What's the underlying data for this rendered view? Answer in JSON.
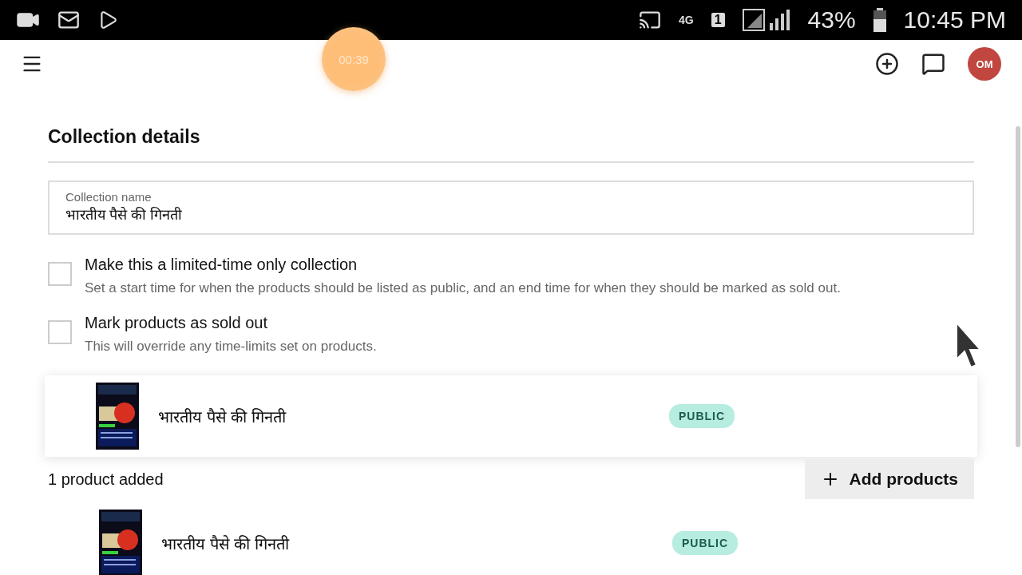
{
  "status_bar": {
    "signal_label": "4G",
    "sim": "1",
    "battery": "43%",
    "time": "10:45 PM"
  },
  "recorder": {
    "timer": "00:39"
  },
  "app_bar": {
    "avatar": "OM"
  },
  "section": {
    "title": "Collection details"
  },
  "collection_name": {
    "label": "Collection name",
    "value": "भारतीय पैसे की गिनती"
  },
  "options": [
    {
      "label": "Make this a limited-time only collection",
      "description": "Set a start time for when the products should be listed as public, and an end time for when they should be marked as sold out.",
      "checked": false
    },
    {
      "label": "Mark products as sold out",
      "description": "This will override any time-limits set on products.",
      "checked": false
    }
  ],
  "dragged_product": {
    "name": "भारतीय पैसे की गिनती",
    "status": "PUBLIC"
  },
  "products_count": "1 product added",
  "add_button": "Add products",
  "products": [
    {
      "name": "भारतीय पैसे की गिनती",
      "status": "PUBLIC"
    }
  ]
}
